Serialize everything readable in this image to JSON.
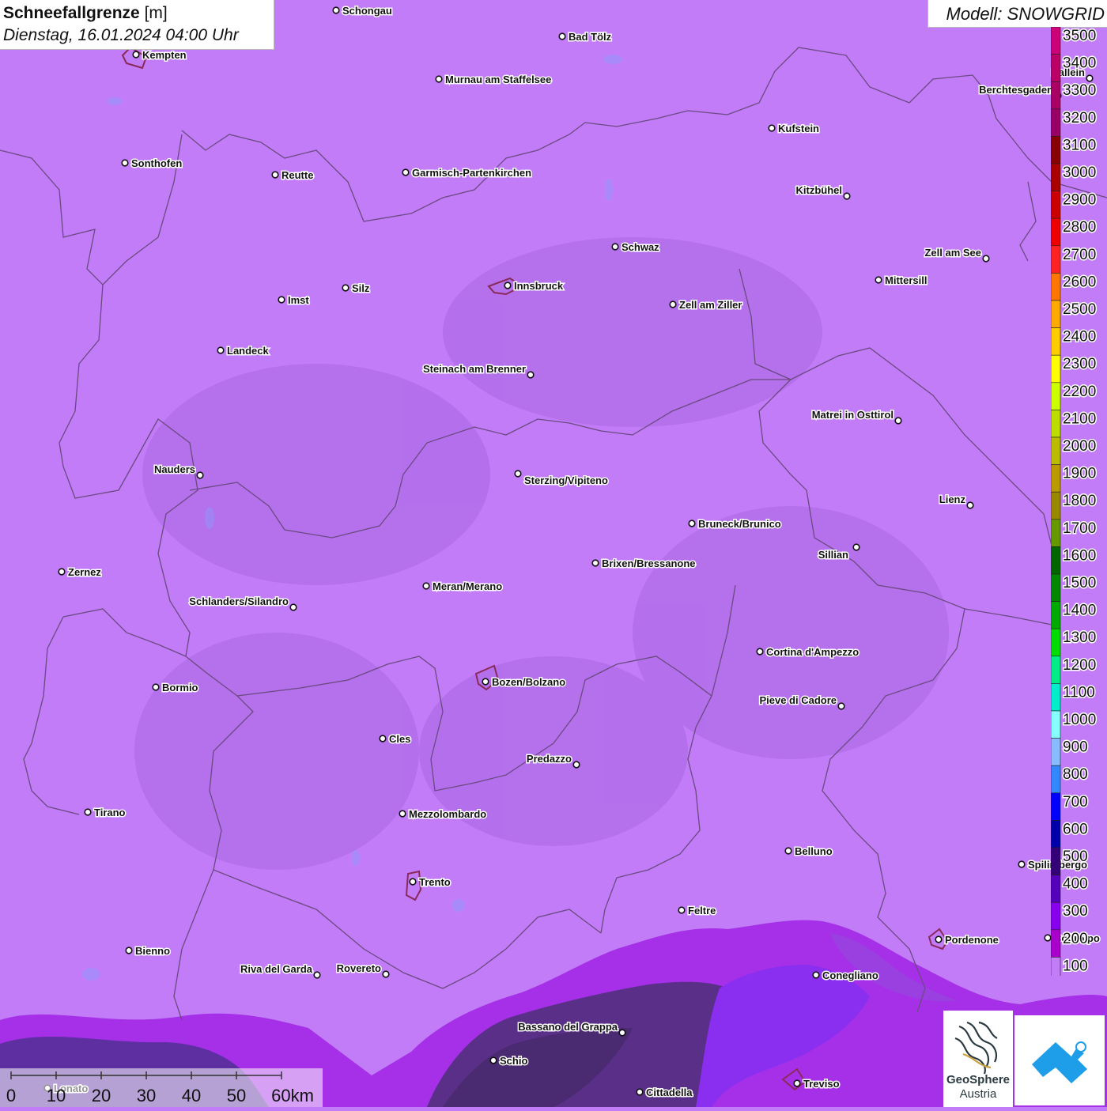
{
  "title": {
    "variable": "Schneefallgrenze",
    "unit": "[m]",
    "datetime": "Dienstag, 16.01.2024 04:00 Uhr"
  },
  "model": {
    "label": "Modell: SNOWGRID"
  },
  "legend": {
    "values": [
      "3500",
      "3400",
      "3300",
      "3200",
      "3100",
      "3000",
      "2900",
      "2800",
      "2700",
      "2600",
      "2500",
      "2400",
      "2300",
      "2200",
      "2100",
      "2000",
      "1900",
      "1800",
      "1700",
      "1600",
      "1500",
      "1400",
      "1300",
      "1200",
      "1100",
      "1000",
      "900",
      "800",
      "700",
      "600",
      "500",
      "400",
      "300",
      "200",
      "100"
    ],
    "colors": [
      "#cc0077",
      "#bb0066",
      "#aa0066",
      "#990066",
      "#880000",
      "#aa0000",
      "#cc0000",
      "#ee0000",
      "#ff2222",
      "#ff7700",
      "#ffaa00",
      "#ffcc00",
      "#ffff00",
      "#ccff00",
      "#bbdd00",
      "#bbbb00",
      "#bb9900",
      "#998800",
      "#669900",
      "#006600",
      "#008800",
      "#00aa00",
      "#00dd00",
      "#00ee88",
      "#00eecc",
      "#88ffff",
      "#88bbff",
      "#3388ff",
      "#0000ff",
      "#0000aa",
      "#330077",
      "#5500bb",
      "#8800ee",
      "#aa00cc",
      "#c27cf8"
    ]
  },
  "scale_bar": {
    "ticks": [
      "0",
      "10",
      "20",
      "30",
      "40",
      "50",
      "60km"
    ]
  },
  "cities": [
    {
      "name": "Schongau"
    },
    {
      "name": "Bad Tölz"
    },
    {
      "name": "Kempten"
    },
    {
      "name": "Murnau am Staffelsee"
    },
    {
      "name": "Hallein"
    },
    {
      "name": "Berchtesgaden"
    },
    {
      "name": "Kufstein"
    },
    {
      "name": "Sonthofen"
    },
    {
      "name": "Reutte"
    },
    {
      "name": "Garmisch-Partenkirchen"
    },
    {
      "name": "Kitzbühel"
    },
    {
      "name": "Schwaz"
    },
    {
      "name": "Zell am See"
    },
    {
      "name": "Innsbruck"
    },
    {
      "name": "Mittersill"
    },
    {
      "name": "Imst"
    },
    {
      "name": "Silz"
    },
    {
      "name": "Zell am Ziller"
    },
    {
      "name": "Landeck"
    },
    {
      "name": "Steinach am Brenner"
    },
    {
      "name": "Matrei in Osttirol"
    },
    {
      "name": "Nauders"
    },
    {
      "name": "Sterzing/Vipiteno"
    },
    {
      "name": "Lienz"
    },
    {
      "name": "Bruneck/Brunico"
    },
    {
      "name": "Sillian"
    },
    {
      "name": "Zernez"
    },
    {
      "name": "Brixen/Bressanone"
    },
    {
      "name": "Meran/Merano"
    },
    {
      "name": "Schlanders/Silandro"
    },
    {
      "name": "Cortina d'Ampezzo"
    },
    {
      "name": "Bozen/Bolzano"
    },
    {
      "name": "Bormio"
    },
    {
      "name": "Pieve di Cadore"
    },
    {
      "name": "Cles"
    },
    {
      "name": "Predazzo"
    },
    {
      "name": "Tirano"
    },
    {
      "name": "Mezzolombardo"
    },
    {
      "name": "Belluno"
    },
    {
      "name": "Spilimbergo"
    },
    {
      "name": "Trento"
    },
    {
      "name": "Feltre"
    },
    {
      "name": "Pordenone"
    },
    {
      "name": "Bienno"
    },
    {
      "name": "Riva del Garda"
    },
    {
      "name": "Rovereto"
    },
    {
      "name": "Conegliano"
    },
    {
      "name": "Bassano del Grappa"
    },
    {
      "name": "Schio"
    },
    {
      "name": "Treviso"
    },
    {
      "name": "Cittadella"
    },
    {
      "name": "Lonato"
    },
    {
      "name": "Codroipo"
    }
  ],
  "logos": {
    "geosphere_line1": "GeoSphere",
    "geosphere_line2": "Austria"
  },
  "colors": {
    "background": "#c27cf8",
    "border": "#6a4a80",
    "low_snowline_dark": "#5a2f88",
    "low_snowline_mid": "#8a2ff0"
  }
}
